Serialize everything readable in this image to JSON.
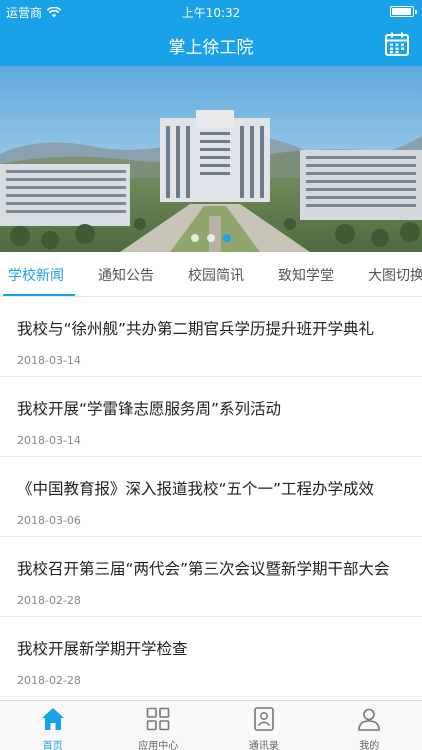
{
  "status_bar": {
    "carrier": "运营商",
    "time": "上午10:32",
    "wifi_icon": "wifi-icon",
    "battery_icon": "battery-icon"
  },
  "header": {
    "title": "掌上徐工院",
    "calendar_icon": "calendar-icon"
  },
  "banner": {
    "image": "campus-building-photo",
    "page_count": 3,
    "active_page": 3
  },
  "tabs": [
    {
      "label": "学校新闻",
      "active": true
    },
    {
      "label": "通知公告",
      "active": false
    },
    {
      "label": "校园简讯",
      "active": false
    },
    {
      "label": "致知学堂",
      "active": false
    },
    {
      "label": "大图切换",
      "active": false
    }
  ],
  "news": [
    {
      "title": "我校与“徐州舰”共办第二期官兵学历提升班开学典礼",
      "date": "2018-03-14"
    },
    {
      "title": "我校开展“学雷锋志愿服务周”系列活动",
      "date": "2018-03-14"
    },
    {
      "title": "《中国教育报》深入报道我校“五个一”工程办学成效",
      "date": "2018-03-06"
    },
    {
      "title": "我校召开第三届“两代会”第三次会议暨新学期干部大会",
      "date": "2018-02-28"
    },
    {
      "title": "我校开展新学期开学检查",
      "date": "2018-02-28"
    }
  ],
  "tab_bar": [
    {
      "label": "首页",
      "icon": "home-icon",
      "active": true
    },
    {
      "label": "应用中心",
      "icon": "apps-grid-icon",
      "active": false
    },
    {
      "label": "通讯录",
      "icon": "contacts-icon",
      "active": false
    },
    {
      "label": "我的",
      "icon": "person-icon",
      "active": false
    }
  ],
  "colors": {
    "accent": "#1aa2e8",
    "text": "#222222",
    "muted": "#888888"
  }
}
